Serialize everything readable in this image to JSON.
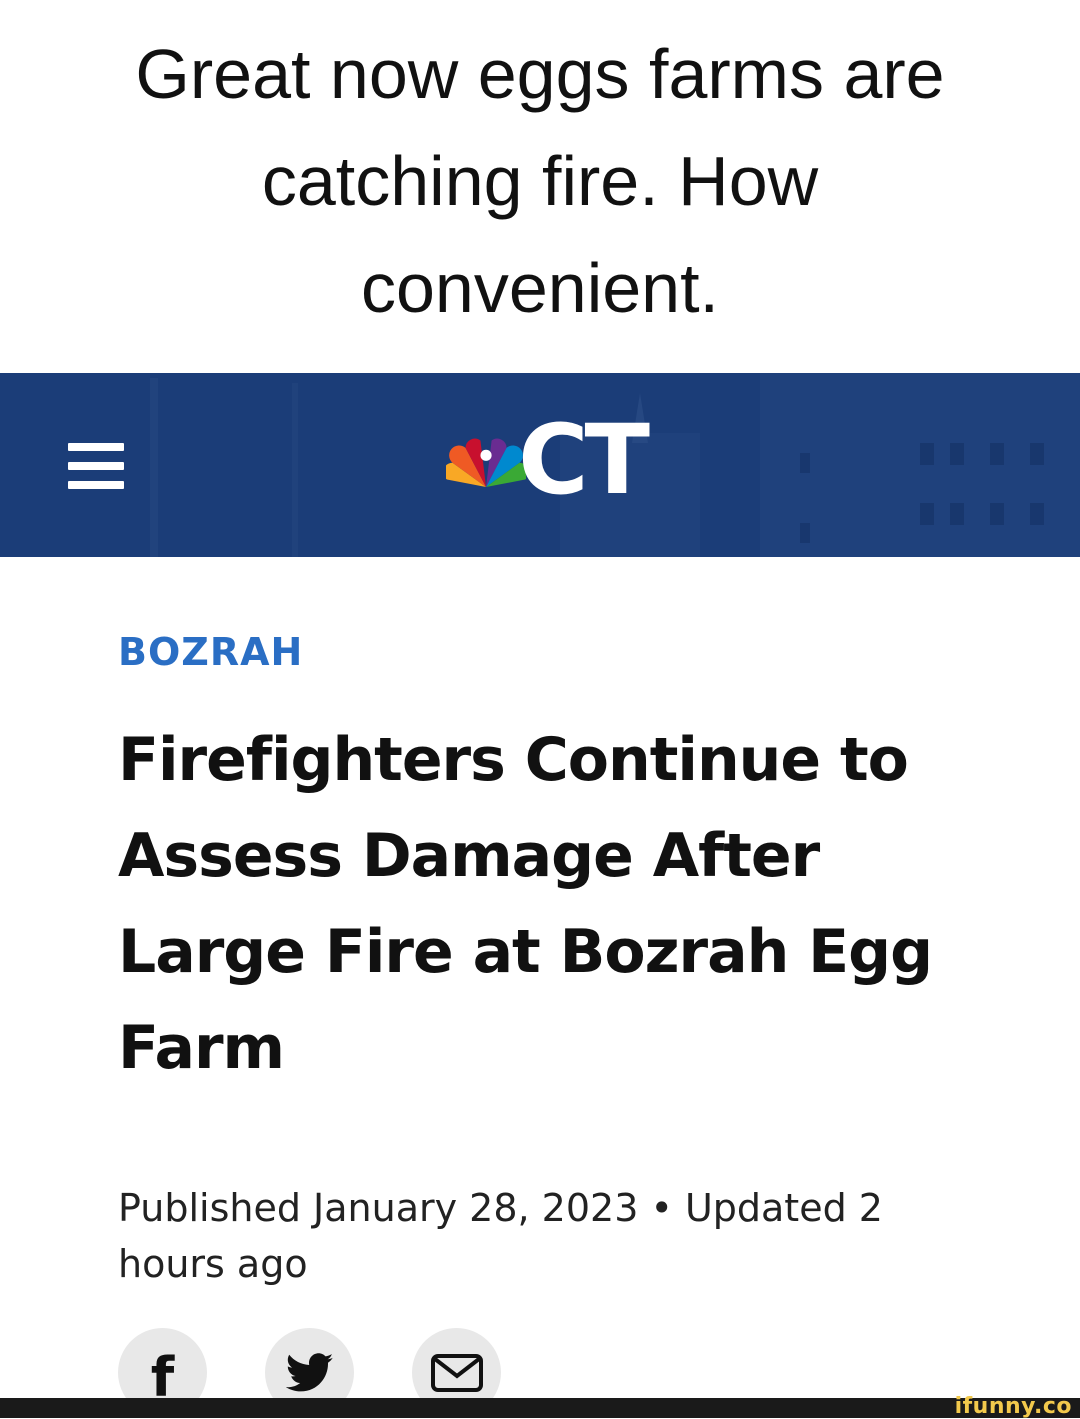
{
  "caption": {
    "text": "Great now eggs farms are catching fire. How convenient."
  },
  "header": {
    "logo_text": "CT",
    "background_color": "#1b3d78",
    "icons": [
      "menu-icon",
      "nbc-peacock-icon"
    ]
  },
  "article": {
    "section": "BOZRAH",
    "section_color": "#2a6ec4",
    "headline": "Firefighters Continue to Assess Damage After Large Fire at Bozrah Egg Farm",
    "published": "Published January 28, 2023 • Updated 2 hours ago"
  },
  "share": {
    "buttons": [
      "facebook-icon",
      "twitter-icon",
      "email-icon"
    ]
  },
  "footer": {
    "watermark": "ifunny.co"
  }
}
